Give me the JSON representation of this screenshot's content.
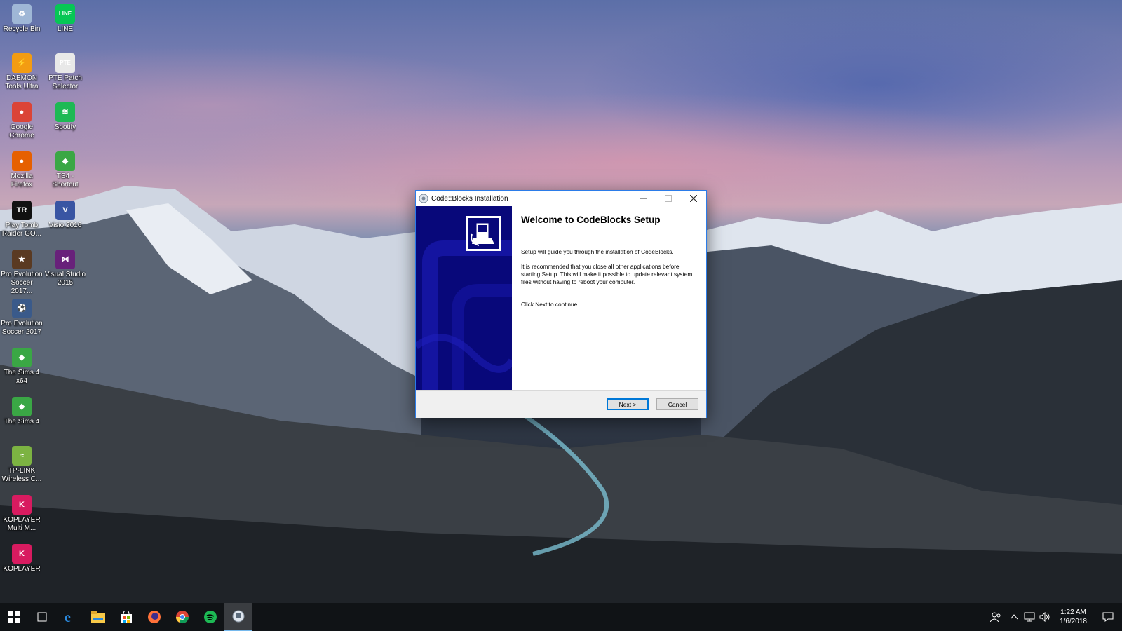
{
  "desktop": {
    "icons": [
      {
        "label": "Recycle Bin",
        "icon": "recycle-bin-icon",
        "color": "#9fb7d6",
        "glyph": "♻"
      },
      {
        "label": "LINE",
        "icon": "line-app-icon",
        "color": "#06c755",
        "glyph": "LINE"
      },
      {
        "label": "DAEMON Tools Ultra",
        "icon": "daemon-tools-icon",
        "color": "#f39c12",
        "glyph": "⚡"
      },
      {
        "label": "PTE Patch Selector",
        "icon": "pte-patch-icon",
        "color": "#e8e8e8",
        "glyph": "PTE"
      },
      {
        "label": "Google Chrome",
        "icon": "chrome-icon",
        "color": "#db4437",
        "glyph": "●"
      },
      {
        "label": "Spotify",
        "icon": "spotify-icon",
        "color": "#1db954",
        "glyph": "≋"
      },
      {
        "label": "Mozilla Firefox",
        "icon": "firefox-icon",
        "color": "#e66000",
        "glyph": "●"
      },
      {
        "label": "TS4 - Shortcut",
        "icon": "sims-plumbob-icon",
        "color": "#3aa745",
        "glyph": "◆"
      },
      {
        "label": "Play Tomb Raider GO...",
        "icon": "tomb-raider-icon",
        "color": "#111111",
        "glyph": "TR"
      },
      {
        "label": "Visio 2016",
        "icon": "visio-icon",
        "color": "#3955a3",
        "glyph": "V"
      },
      {
        "label": "Pro Evolution Soccer 2017...",
        "icon": "pes-icon",
        "color": "#5a3a22",
        "glyph": "★"
      },
      {
        "label": "Visual Studio 2015",
        "icon": "visual-studio-icon",
        "color": "#68217a",
        "glyph": "⋈"
      },
      {
        "label": "Pro Evolution Soccer 2017",
        "icon": "pes-2017-icon",
        "color": "#3a5a8a",
        "glyph": "⚽"
      },
      {
        "label": "The Sims 4 x64",
        "icon": "sims4-x64-icon",
        "color": "#3aa745",
        "glyph": "◆"
      },
      {
        "label": "The Sims 4",
        "icon": "sims4-icon",
        "color": "#3aa745",
        "glyph": "◆"
      },
      {
        "label": "TP-LINK Wireless C...",
        "icon": "tplink-icon",
        "color": "#7cb342",
        "glyph": "≈"
      },
      {
        "label": "KOPLAYER Multi M...",
        "icon": "koplayer-multi-icon",
        "color": "#d81b60",
        "glyph": "K"
      },
      {
        "label": "KOPLAYER",
        "icon": "koplayer-icon",
        "color": "#d81b60",
        "glyph": "K"
      }
    ]
  },
  "window": {
    "title": "Code::Blocks Installation",
    "heading": "Welcome to CodeBlocks Setup",
    "para1": "Setup will guide you through the installation of CodeBlocks.",
    "para2": "It is recommended that you close all other applications before starting Setup. This will make it possible to update relevant system files without having to reboot your computer.",
    "para3": "Click Next to continue.",
    "next_label": "Next >",
    "cancel_label": "Cancel",
    "colors": {
      "side_panel": "#08087a",
      "accent": "#0078d7"
    }
  },
  "taskbar": {
    "apps": [
      {
        "name": "task-view-icon",
        "active": false
      },
      {
        "name": "edge-icon",
        "active": false
      },
      {
        "name": "file-explorer-icon",
        "active": false
      },
      {
        "name": "store-icon",
        "active": false
      },
      {
        "name": "firefox-icon",
        "active": false
      },
      {
        "name": "chrome-icon",
        "active": false
      },
      {
        "name": "spotify-icon",
        "active": false
      },
      {
        "name": "codeblocks-installer-icon",
        "active": true
      }
    ],
    "time": "1:22 AM",
    "date": "1/6/2018"
  }
}
